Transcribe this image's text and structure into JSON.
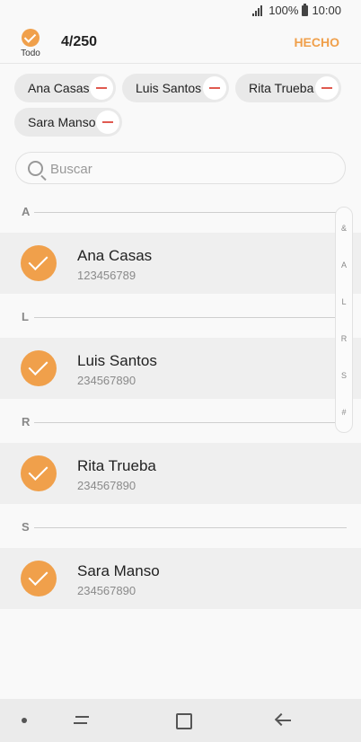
{
  "status_bar": {
    "battery": "100%",
    "time": "10:00"
  },
  "header": {
    "select_all_label": "Todo",
    "selected_count": "4/250",
    "done_label": "HECHO"
  },
  "selected_chips": [
    "Ana Casas",
    "Luis Santos",
    "Rita Trueba",
    "Sara Manso"
  ],
  "search": {
    "placeholder": "Buscar",
    "value": ""
  },
  "sections": [
    {
      "letter": "A",
      "contacts": [
        {
          "name": "Ana Casas",
          "number": "123456789",
          "checked": true
        }
      ]
    },
    {
      "letter": "L",
      "contacts": [
        {
          "name": "Luis Santos",
          "number": "234567890",
          "checked": true
        }
      ]
    },
    {
      "letter": "R",
      "contacts": [
        {
          "name": "Rita Trueba",
          "number": "234567890",
          "checked": true
        }
      ]
    },
    {
      "letter": "S",
      "contacts": [
        {
          "name": "Sara Manso",
          "number": "234567890",
          "checked": true
        }
      ]
    }
  ],
  "index_bar": [
    "&",
    "A",
    "L",
    "R",
    "S",
    "#"
  ],
  "colors": {
    "accent": "#f0a04b",
    "remove": "#e05a50"
  }
}
